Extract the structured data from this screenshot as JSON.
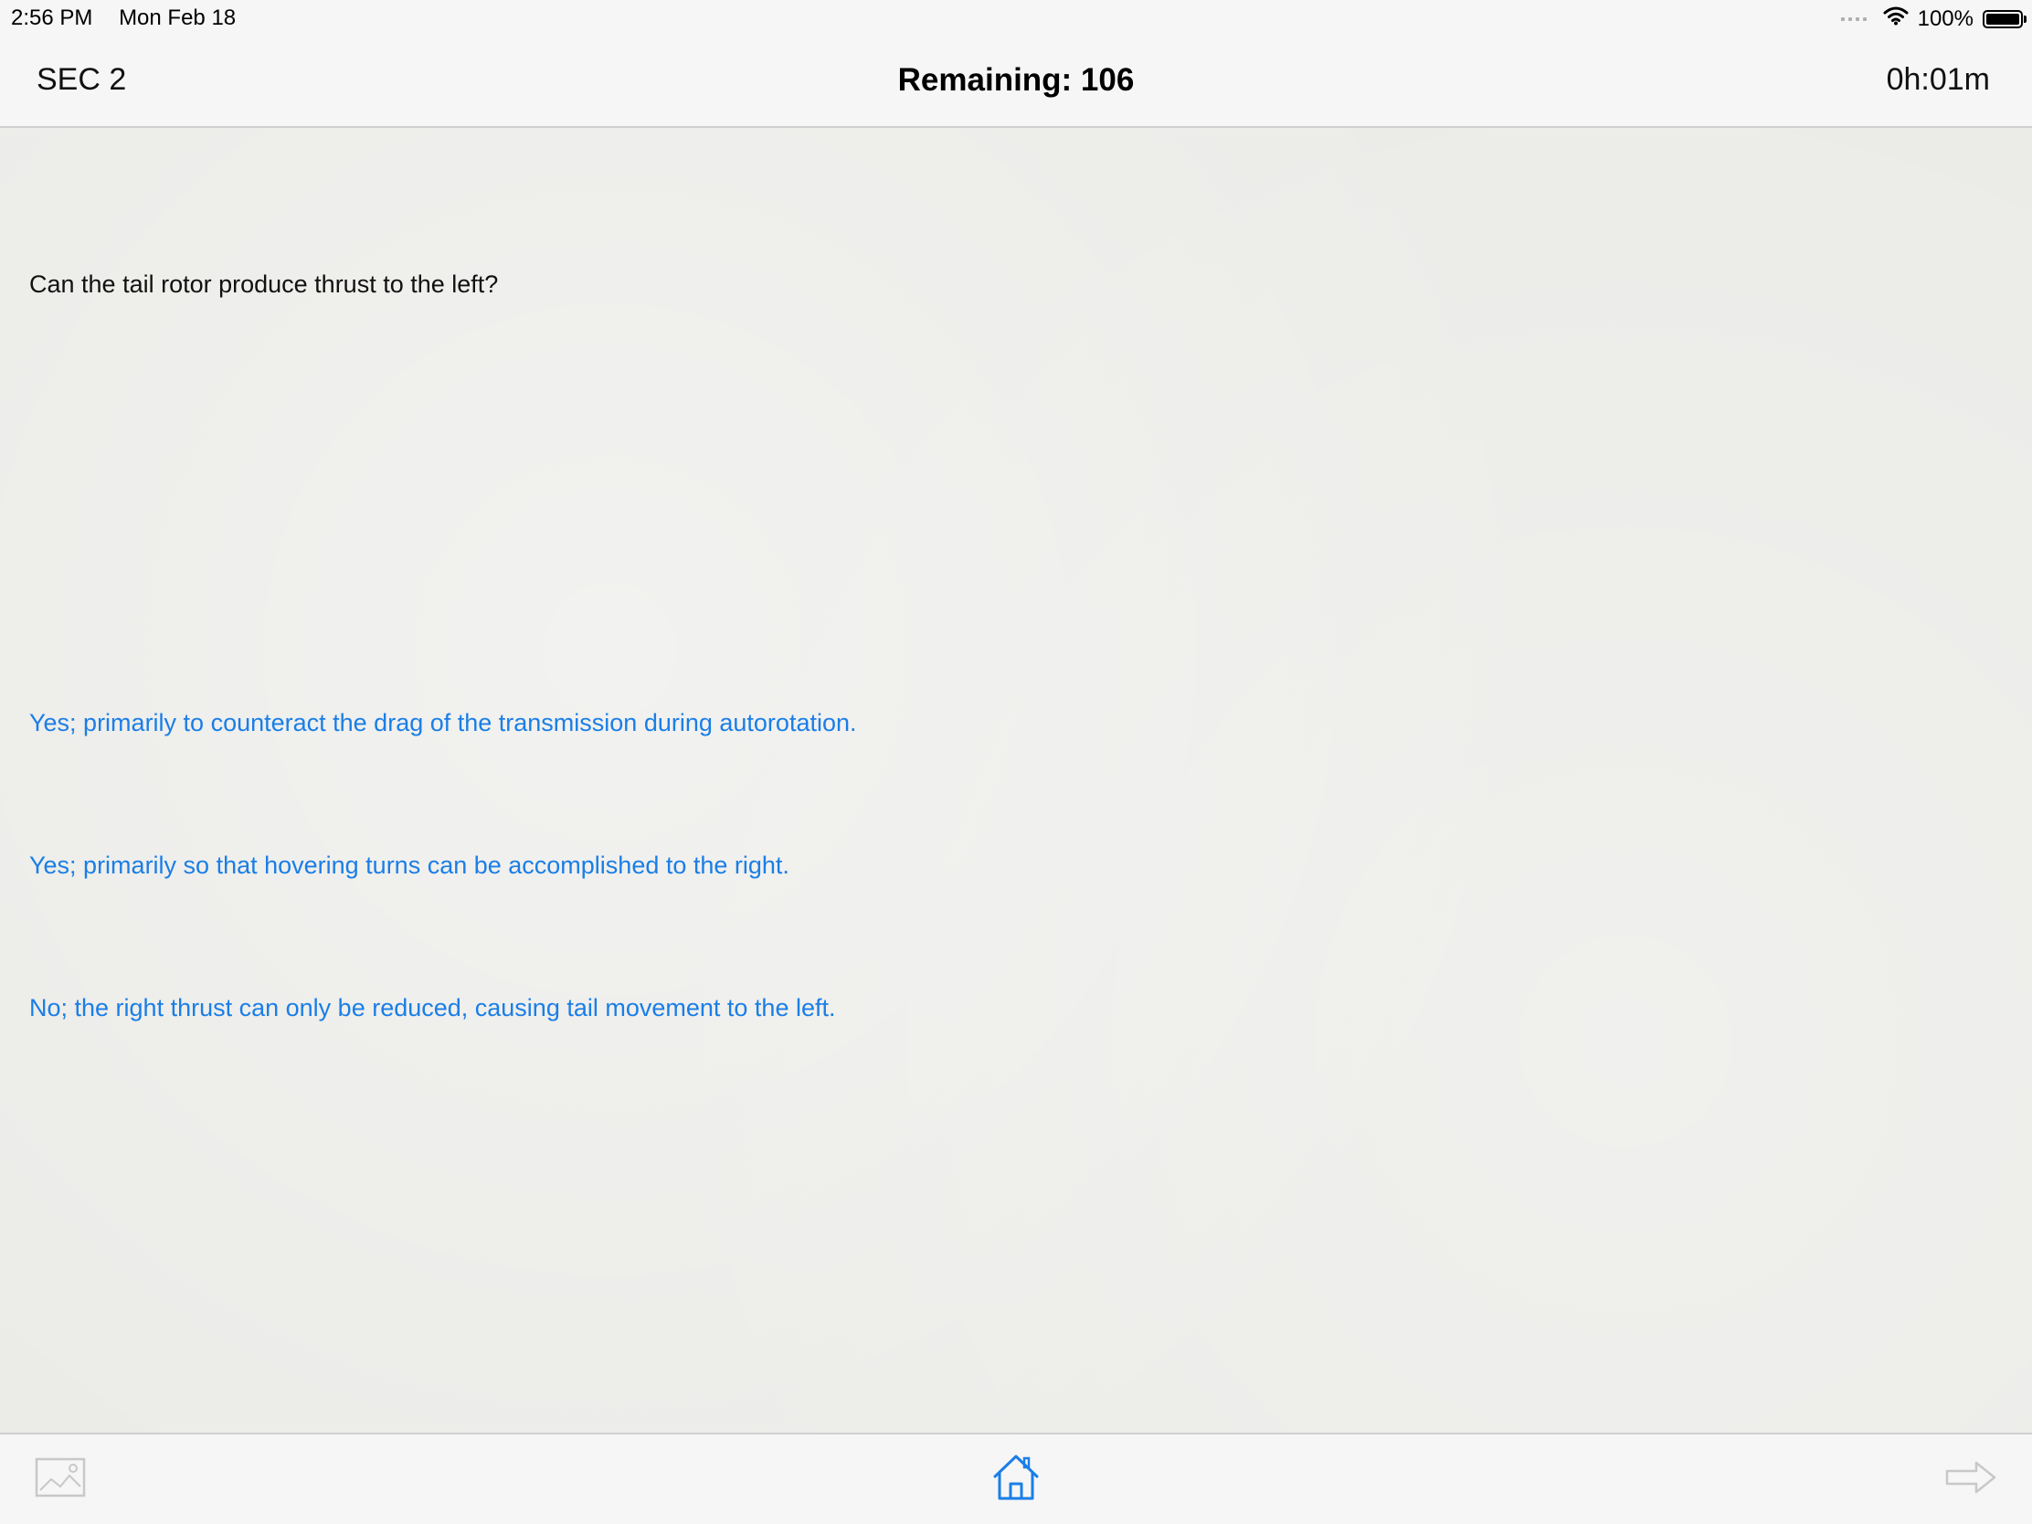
{
  "status_bar": {
    "time": "2:56 PM",
    "date": "Mon Feb 18",
    "battery": "100%",
    "icons": [
      "signal-dots-icon",
      "wifi-icon",
      "battery-icon"
    ]
  },
  "nav": {
    "section": "SEC 2",
    "title": "Remaining: 106",
    "timer": "0h:01m"
  },
  "question": {
    "text": "Can the tail rotor produce thrust to the left?"
  },
  "answers": [
    {
      "text": "Yes; primarily to counteract the drag of the transmission during autorotation."
    },
    {
      "text": "Yes; primarily so that hovering turns can be accomplished to the right."
    },
    {
      "text": "No; the right thrust can only be reduced, causing tail movement to the left."
    }
  ],
  "toolbar": {
    "icons": [
      "image-icon",
      "home-icon",
      "next-arrow-icon"
    ]
  },
  "colors": {
    "accent": "#1a7ee6",
    "background": "#ebebe8",
    "bars": "#f6f6f6"
  }
}
